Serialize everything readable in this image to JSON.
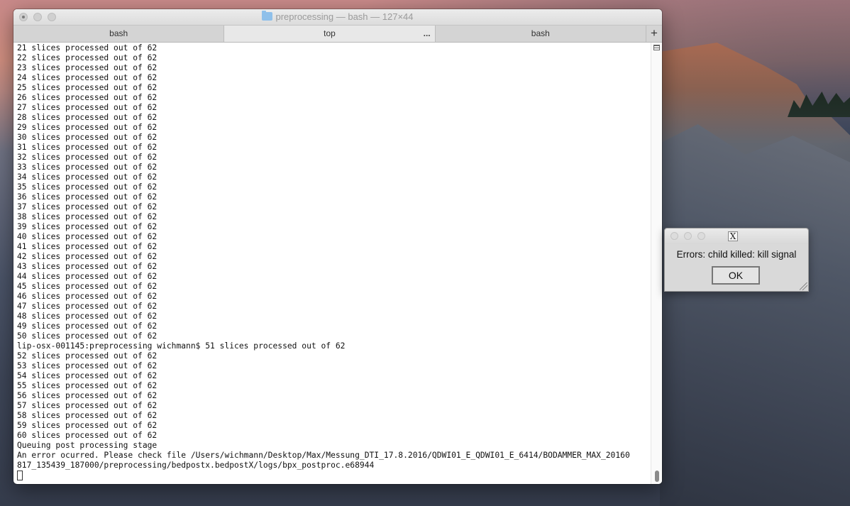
{
  "window": {
    "title": "preprocessing — bash — 127×44",
    "tabs": [
      {
        "label": "bash",
        "active": false
      },
      {
        "label": "top",
        "active": true,
        "extra": "..."
      },
      {
        "label": "bash",
        "active": false
      }
    ],
    "add_tab": "+"
  },
  "terminal": {
    "lines": [
      "21 slices processed out of 62",
      "22 slices processed out of 62",
      "23 slices processed out of 62",
      "24 slices processed out of 62",
      "25 slices processed out of 62",
      "26 slices processed out of 62",
      "27 slices processed out of 62",
      "28 slices processed out of 62",
      "29 slices processed out of 62",
      "30 slices processed out of 62",
      "31 slices processed out of 62",
      "32 slices processed out of 62",
      "33 slices processed out of 62",
      "34 slices processed out of 62",
      "35 slices processed out of 62",
      "36 slices processed out of 62",
      "37 slices processed out of 62",
      "38 slices processed out of 62",
      "39 slices processed out of 62",
      "40 slices processed out of 62",
      "41 slices processed out of 62",
      "42 slices processed out of 62",
      "43 slices processed out of 62",
      "44 slices processed out of 62",
      "45 slices processed out of 62",
      "46 slices processed out of 62",
      "47 slices processed out of 62",
      "48 slices processed out of 62",
      "49 slices processed out of 62",
      "50 slices processed out of 62",
      "lip-osx-001145:preprocessing wichmann$ 51 slices processed out of 62",
      "52 slices processed out of 62",
      "53 slices processed out of 62",
      "54 slices processed out of 62",
      "55 slices processed out of 62",
      "56 slices processed out of 62",
      "57 slices processed out of 62",
      "58 slices processed out of 62",
      "59 slices processed out of 62",
      "60 slices processed out of 62",
      "Queuing post processing stage",
      "An error ocurred. Please check file /Users/wichmann/Desktop/Max/Messung_DTI_17.8.2016/QDWI01_E_QDWI01_E_6414/BODAMMER_MAX_20160",
      "817_135439_187000/preprocessing/bedpostx.bedpostX/logs/bpx_postproc.e68944"
    ]
  },
  "dialog": {
    "icon": "X",
    "message": "Errors: child killed: kill signal",
    "ok_label": "OK"
  }
}
